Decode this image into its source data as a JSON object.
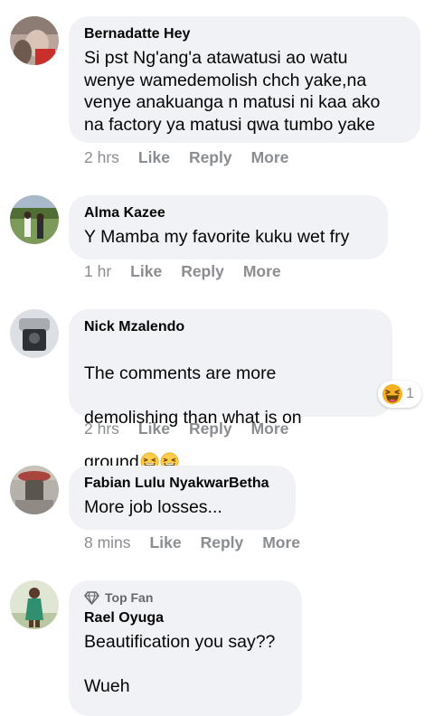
{
  "actions": {
    "like": "Like",
    "reply": "Reply",
    "more": "More"
  },
  "comments": [
    {
      "author": "Bernadatte Hey",
      "text": "Si pst Ng'ang'a atawatusi ao watu\nwenye wamedemolish chch yake,na\nvenye anakuanga n matusi ni kaa ako\nna factory ya matusi qwa tumbo yake",
      "time": "2 hrs"
    },
    {
      "author": "Alma Kazee",
      "text": "Y Mamba my favorite kuku wet fry",
      "time": "1 hr"
    },
    {
      "author": "Nick Mzalendo",
      "text_line1": "The comments are more",
      "text_line2": "demolishing than what is on",
      "text_line3": "ground",
      "emoji": "grinning-squinting-face",
      "reaction_icon": "laughing-reaction",
      "reaction_count": "1",
      "time": "2 hrs"
    },
    {
      "author": "Fabian Lulu NyakwarBetha",
      "text": "More job losses...",
      "time": "8 mins"
    },
    {
      "badge": "Top Fan",
      "badge_icon": "diamond-icon",
      "author": "Rael Oyuga",
      "text": "Beautification you say??\n\nWueh"
    }
  ],
  "colors": {
    "bubble": "#f0f2f5",
    "meta_text": "#8a8d91",
    "author_text": "#050505",
    "topfan_text": "#65676b"
  }
}
